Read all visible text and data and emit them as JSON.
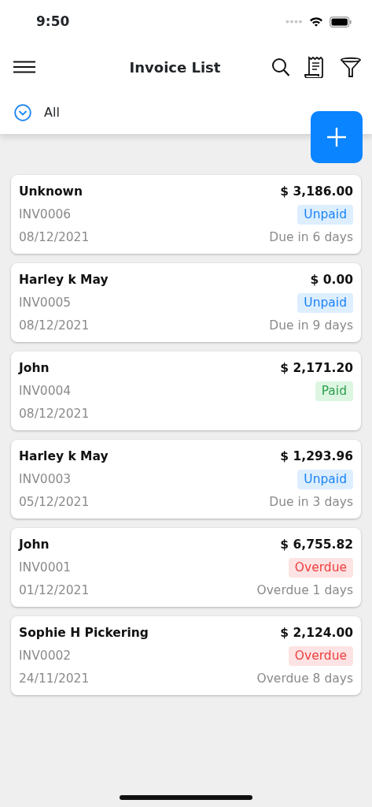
{
  "status_bar": {
    "time": "9:50"
  },
  "header": {
    "title": "Invoice List"
  },
  "filter": {
    "label": "All"
  },
  "invoices": [
    {
      "customer": "Unknown",
      "amount": "$ 3,186.00",
      "number": "INV0006",
      "status": "Unpaid",
      "kind": "unpaid",
      "date": "08/12/2021",
      "due": "Due in 6 days"
    },
    {
      "customer": "Harley k May",
      "amount": "$ 0.00",
      "number": "INV0005",
      "status": "Unpaid",
      "kind": "unpaid",
      "date": "08/12/2021",
      "due": "Due in 9 days"
    },
    {
      "customer": "John",
      "amount": "$ 2,171.20",
      "number": "INV0004",
      "status": "Paid",
      "kind": "paid",
      "date": "08/12/2021"
    },
    {
      "customer": "Harley k May",
      "amount": "$ 1,293.96",
      "number": "INV0003",
      "status": "Unpaid",
      "kind": "unpaid",
      "date": "05/12/2021",
      "due": "Due in 3 days"
    },
    {
      "customer": "John",
      "amount": "$ 6,755.82",
      "number": "INV0001",
      "status": "Overdue",
      "kind": "overdue",
      "date": "01/12/2021",
      "due": "Overdue 1 days"
    },
    {
      "customer": "Sophie H Pickering",
      "amount": "$ 2,124.00",
      "number": "INV0002",
      "status": "Overdue",
      "kind": "overdue",
      "date": "24/11/2021",
      "due": "Overdue 8 days"
    }
  ]
}
